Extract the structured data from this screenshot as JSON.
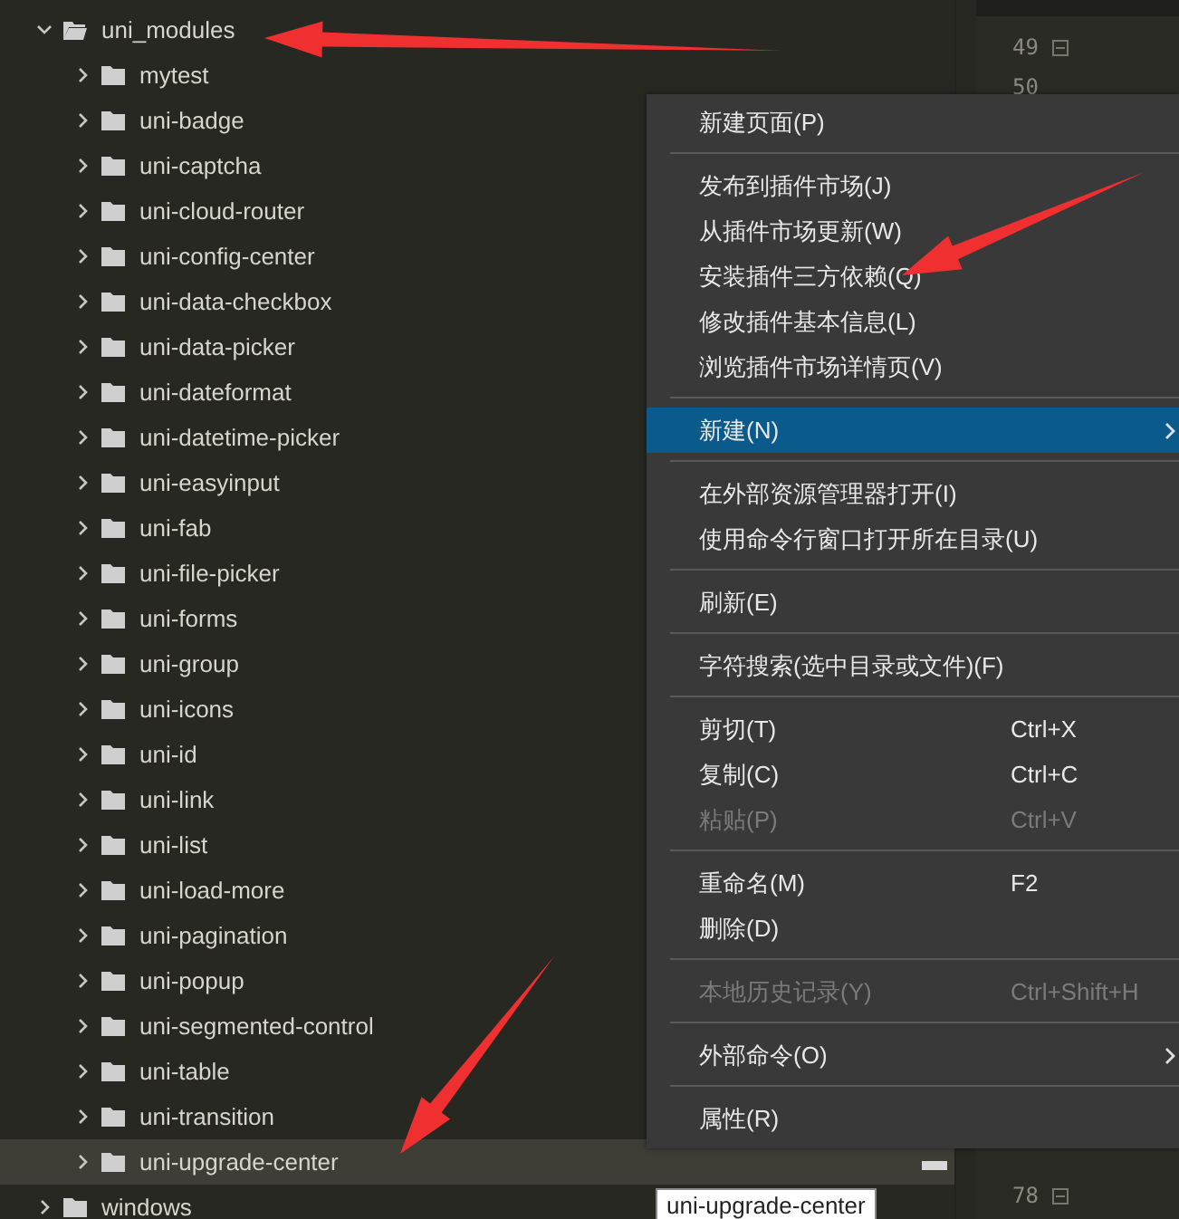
{
  "tree": [
    {
      "label": "uni_modules",
      "expanded": true,
      "highlighted": false,
      "children": [
        {
          "label": "mytest",
          "expanded": false,
          "highlighted": false
        },
        {
          "label": "uni-badge",
          "expanded": false,
          "highlighted": false
        },
        {
          "label": "uni-captcha",
          "expanded": false,
          "highlighted": false
        },
        {
          "label": "uni-cloud-router",
          "expanded": false,
          "highlighted": false
        },
        {
          "label": "uni-config-center",
          "expanded": false,
          "highlighted": false
        },
        {
          "label": "uni-data-checkbox",
          "expanded": false,
          "highlighted": false
        },
        {
          "label": "uni-data-picker",
          "expanded": false,
          "highlighted": false
        },
        {
          "label": "uni-dateformat",
          "expanded": false,
          "highlighted": false
        },
        {
          "label": "uni-datetime-picker",
          "expanded": false,
          "highlighted": false
        },
        {
          "label": "uni-easyinput",
          "expanded": false,
          "highlighted": false
        },
        {
          "label": "uni-fab",
          "expanded": false,
          "highlighted": false
        },
        {
          "label": "uni-file-picker",
          "expanded": false,
          "highlighted": false
        },
        {
          "label": "uni-forms",
          "expanded": false,
          "highlighted": false
        },
        {
          "label": "uni-group",
          "expanded": false,
          "highlighted": false
        },
        {
          "label": "uni-icons",
          "expanded": false,
          "highlighted": false
        },
        {
          "label": "uni-id",
          "expanded": false,
          "highlighted": false
        },
        {
          "label": "uni-link",
          "expanded": false,
          "highlighted": false
        },
        {
          "label": "uni-list",
          "expanded": false,
          "highlighted": false
        },
        {
          "label": "uni-load-more",
          "expanded": false,
          "highlighted": false
        },
        {
          "label": "uni-pagination",
          "expanded": false,
          "highlighted": false
        },
        {
          "label": "uni-popup",
          "expanded": false,
          "highlighted": false
        },
        {
          "label": "uni-segmented-control",
          "expanded": false,
          "highlighted": false
        },
        {
          "label": "uni-table",
          "expanded": false,
          "highlighted": false
        },
        {
          "label": "uni-transition",
          "expanded": false,
          "highlighted": false
        },
        {
          "label": "uni-upgrade-center",
          "expanded": false,
          "highlighted": true
        }
      ]
    },
    {
      "label": "windows",
      "expanded": false,
      "highlighted": false
    }
  ],
  "editor": {
    "top_lines": [
      "49",
      "50"
    ],
    "bottom_lines": [
      "78"
    ]
  },
  "context_menu": [
    {
      "kind": "item",
      "label": "新建页面(P)",
      "selected": false,
      "disabled": false,
      "submenu": false
    },
    {
      "kind": "separator"
    },
    {
      "kind": "item",
      "label": "发布到插件市场(J)",
      "selected": false,
      "disabled": false,
      "submenu": false
    },
    {
      "kind": "item",
      "label": "从插件市场更新(W)",
      "selected": false,
      "disabled": false,
      "submenu": false
    },
    {
      "kind": "item",
      "label": "安装插件三方依赖(Q)",
      "selected": false,
      "disabled": false,
      "submenu": false
    },
    {
      "kind": "item",
      "label": "修改插件基本信息(L)",
      "selected": false,
      "disabled": false,
      "submenu": false
    },
    {
      "kind": "item",
      "label": "浏览插件市场详情页(V)",
      "selected": false,
      "disabled": false,
      "submenu": false
    },
    {
      "kind": "separator"
    },
    {
      "kind": "item",
      "label": "新建(N)",
      "selected": true,
      "disabled": false,
      "submenu": true
    },
    {
      "kind": "separator"
    },
    {
      "kind": "item",
      "label": "在外部资源管理器打开(I)",
      "selected": false,
      "disabled": false,
      "submenu": false
    },
    {
      "kind": "item",
      "label": "使用命令行窗口打开所在目录(U)",
      "selected": false,
      "disabled": false,
      "submenu": false
    },
    {
      "kind": "separator"
    },
    {
      "kind": "item",
      "label": "刷新(E)",
      "selected": false,
      "disabled": false,
      "submenu": false
    },
    {
      "kind": "separator"
    },
    {
      "kind": "item",
      "label": "字符搜索(选中目录或文件)(F)",
      "selected": false,
      "disabled": false,
      "submenu": false
    },
    {
      "kind": "separator"
    },
    {
      "kind": "item",
      "label": "剪切(T)",
      "shortcut": "Ctrl+X",
      "selected": false,
      "disabled": false,
      "submenu": false
    },
    {
      "kind": "item",
      "label": "复制(C)",
      "shortcut": "Ctrl+C",
      "selected": false,
      "disabled": false,
      "submenu": false
    },
    {
      "kind": "item",
      "label": "粘贴(P)",
      "shortcut": "Ctrl+V",
      "selected": false,
      "disabled": true,
      "submenu": false
    },
    {
      "kind": "separator"
    },
    {
      "kind": "item",
      "label": "重命名(M)",
      "shortcut": "F2",
      "selected": false,
      "disabled": false,
      "submenu": false
    },
    {
      "kind": "item",
      "label": "删除(D)",
      "selected": false,
      "disabled": false,
      "submenu": false
    },
    {
      "kind": "separator"
    },
    {
      "kind": "item",
      "label": "本地历史记录(Y)",
      "shortcut": "Ctrl+Shift+H",
      "selected": false,
      "disabled": true,
      "submenu": false
    },
    {
      "kind": "separator"
    },
    {
      "kind": "item",
      "label": "外部命令(O)",
      "selected": false,
      "disabled": false,
      "submenu": true
    },
    {
      "kind": "separator"
    },
    {
      "kind": "item",
      "label": "属性(R)",
      "selected": false,
      "disabled": false,
      "submenu": false
    }
  ],
  "tooltip": "uni-upgrade-center"
}
